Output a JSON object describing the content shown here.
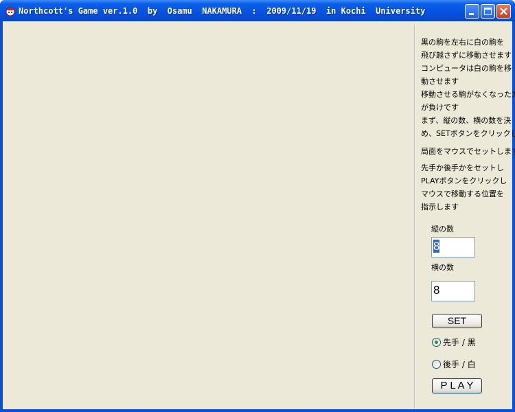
{
  "window": {
    "title": "Northcott's Game ver.1.0  by  Osamu  NAKAMURA  :  2009/11/19  in Kochi  University",
    "icon": "app-icon",
    "controls": [
      "minimize-icon",
      "maximize-icon",
      "close-icon"
    ]
  },
  "help": {
    "lines": [
      "黒の駒を左右に白の駒を",
      "飛び越さずに移動させます",
      "コンピュータは白の駒を移",
      "動させます",
      "移動させる駒がなくなった方",
      "が負けです",
      "まず、縦の数、横の数を決",
      "め、SETボタンをクリックし",
      "局面をマウスでセットします",
      "先手か後手かをセットし",
      "PLAYボタンをクリックし",
      "マウスで移動する位置を",
      "指示します"
    ]
  },
  "controls": {
    "rows_label": "縦の数",
    "rows_value": "8",
    "cols_label": "横の数",
    "cols_value": "8",
    "set_label": "SET",
    "first_label": "先手 / 黒",
    "second_label": "後手 / 白",
    "selected_turn": "first",
    "play_label": "P L A Y"
  }
}
